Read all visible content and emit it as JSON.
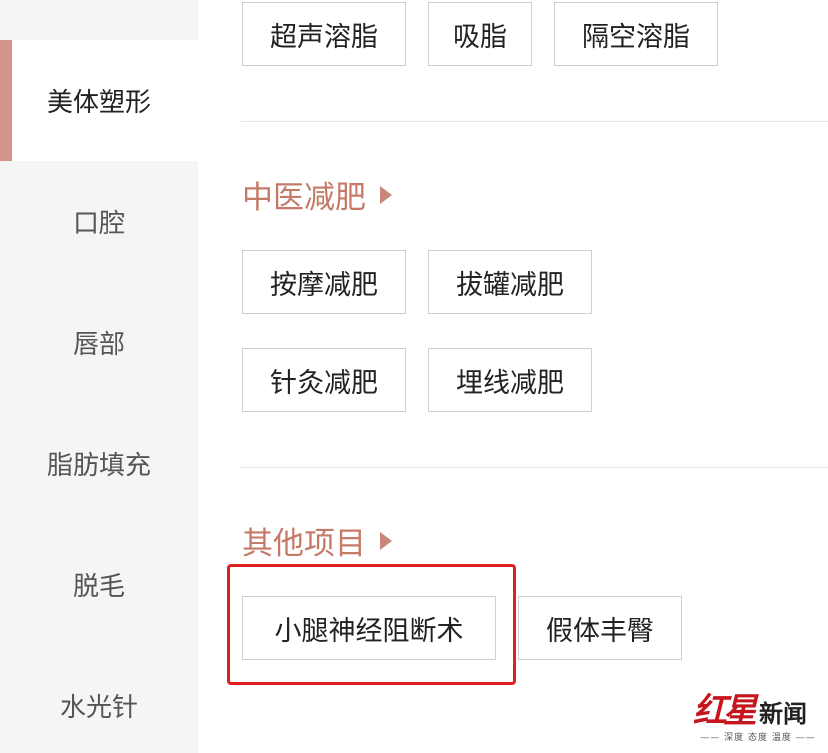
{
  "sidebar": {
    "items": [
      {
        "label": "美体塑形",
        "active": true
      },
      {
        "label": "口腔",
        "active": false
      },
      {
        "label": "唇部",
        "active": false
      },
      {
        "label": "脂肪填充",
        "active": false
      },
      {
        "label": "脱毛",
        "active": false
      },
      {
        "label": "水光针",
        "active": false
      }
    ]
  },
  "content": {
    "top_tags": [
      "超声溶脂",
      "吸脂",
      "隔空溶脂"
    ],
    "sections": [
      {
        "title": "中医减肥",
        "tags": [
          "按摩减肥",
          "拔罐减肥",
          "针灸减肥",
          "埋线减肥"
        ]
      },
      {
        "title": "其他项目",
        "tags": [
          "小腿神经阻断术",
          "假体丰臀"
        ]
      }
    ]
  },
  "watermark": {
    "logo_text_1": "红",
    "logo_text_2": "星",
    "logo_text_3": "新闻",
    "slogan": "—— 深度 态度 温度 ——"
  },
  "colors": {
    "accent": "#c57a68",
    "sidebar_bg": "#f5f5f5",
    "active_bar": "#d4948d",
    "highlight": "#e02020",
    "brand_red": "#c4161c"
  }
}
